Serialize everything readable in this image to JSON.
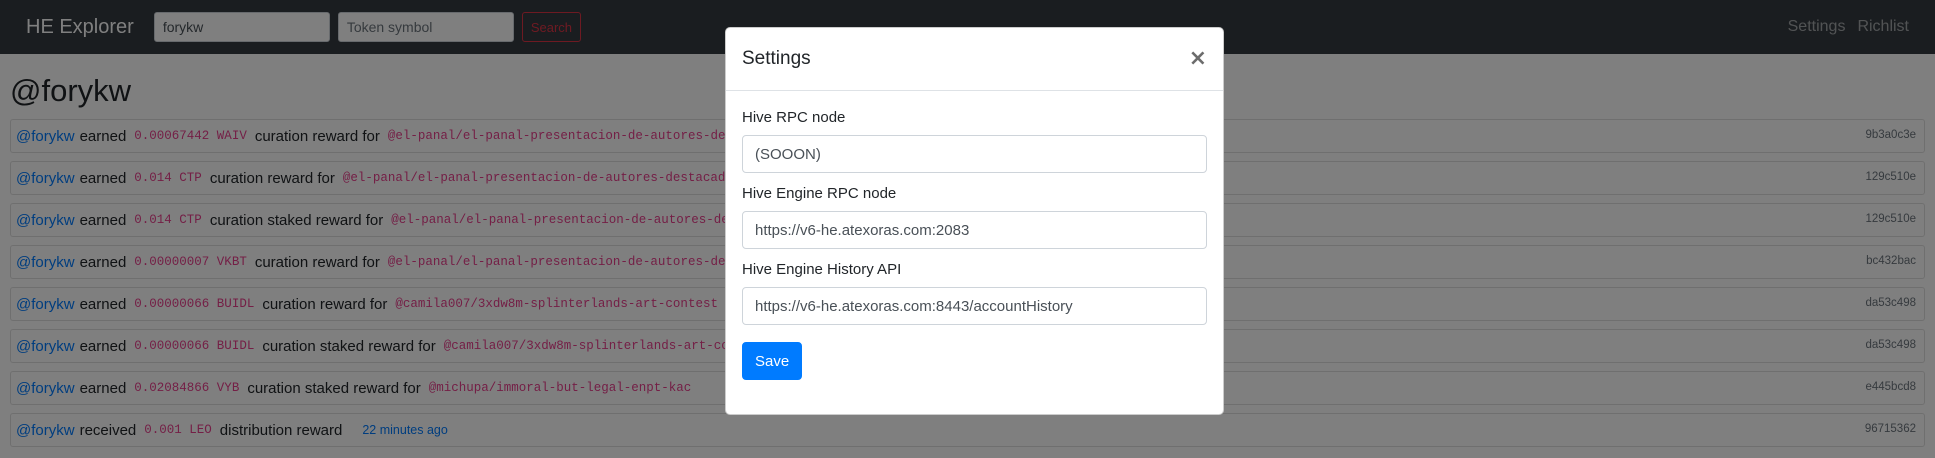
{
  "navbar": {
    "brand": "HE Explorer",
    "account_input_value": "forykw",
    "token_input_placeholder": "Token symbol",
    "search_label": "Search",
    "settings_label": "Settings",
    "richlist_label": "Richlist"
  },
  "page": {
    "account_title": "@forykw"
  },
  "transactions": [
    {
      "user": "@forykw",
      "verb": "earned",
      "amount": "0.00067442 WAIV",
      "desc": "curation reward for",
      "permlink": "@el-panal/el-panal-presentacion-de-autores-destacados",
      "txid": "9b3a0c3e"
    },
    {
      "user": "@forykw",
      "verb": "earned",
      "amount": "0.014 CTP",
      "desc": "curation reward for",
      "permlink": "@el-panal/el-panal-presentacion-de-autores-destacados",
      "txid": "129c510e"
    },
    {
      "user": "@forykw",
      "verb": "earned",
      "amount": "0.014 CTP",
      "desc": "curation staked reward for",
      "permlink": "@el-panal/el-panal-presentacion-de-autores-destacados",
      "txid": "129c510e"
    },
    {
      "user": "@forykw",
      "verb": "earned",
      "amount": "0.00000007 VKBT",
      "desc": "curation reward for",
      "permlink": "@el-panal/el-panal-presentacion-de-autores-destacados",
      "txid": "bc432bac"
    },
    {
      "user": "@forykw",
      "verb": "earned",
      "amount": "0.00000066 BUIDL",
      "desc": "curation reward for",
      "permlink": "@camila007/3xdw8m-splinterlands-art-contest",
      "txid": "da53c498"
    },
    {
      "user": "@forykw",
      "verb": "earned",
      "amount": "0.00000066 BUIDL",
      "desc": "curation staked reward for",
      "permlink": "@camila007/3xdw8m-splinterlands-art-contest",
      "txid": "da53c498"
    },
    {
      "user": "@forykw",
      "verb": "earned",
      "amount": "0.02084866 VYB",
      "desc": "curation staked reward for",
      "permlink": "@michupa/immoral-but-legal-enpt-kac",
      "txid": "e445bcd8"
    },
    {
      "user": "@forykw",
      "verb": "received",
      "amount": "0.001 LEO",
      "desc": "distribution reward",
      "time": "22 minutes ago",
      "txid": "96715362"
    }
  ],
  "modal": {
    "title": "Settings",
    "close_symbol": "×",
    "fields": [
      {
        "label": "Hive RPC node",
        "value": "(SOOON)"
      },
      {
        "label": "Hive Engine RPC node",
        "value": "https://v6-he.atexoras.com:2083"
      },
      {
        "label": "Hive Engine History API",
        "value": "https://v6-he.atexoras.com:8443/accountHistory"
      }
    ],
    "save_label": "Save"
  },
  "colors": {
    "navbar_bg": "#343a40",
    "link_blue": "#007bff",
    "code_pink": "#e83e8c",
    "search_red": "#dc3545",
    "primary_button": "#007bff"
  }
}
